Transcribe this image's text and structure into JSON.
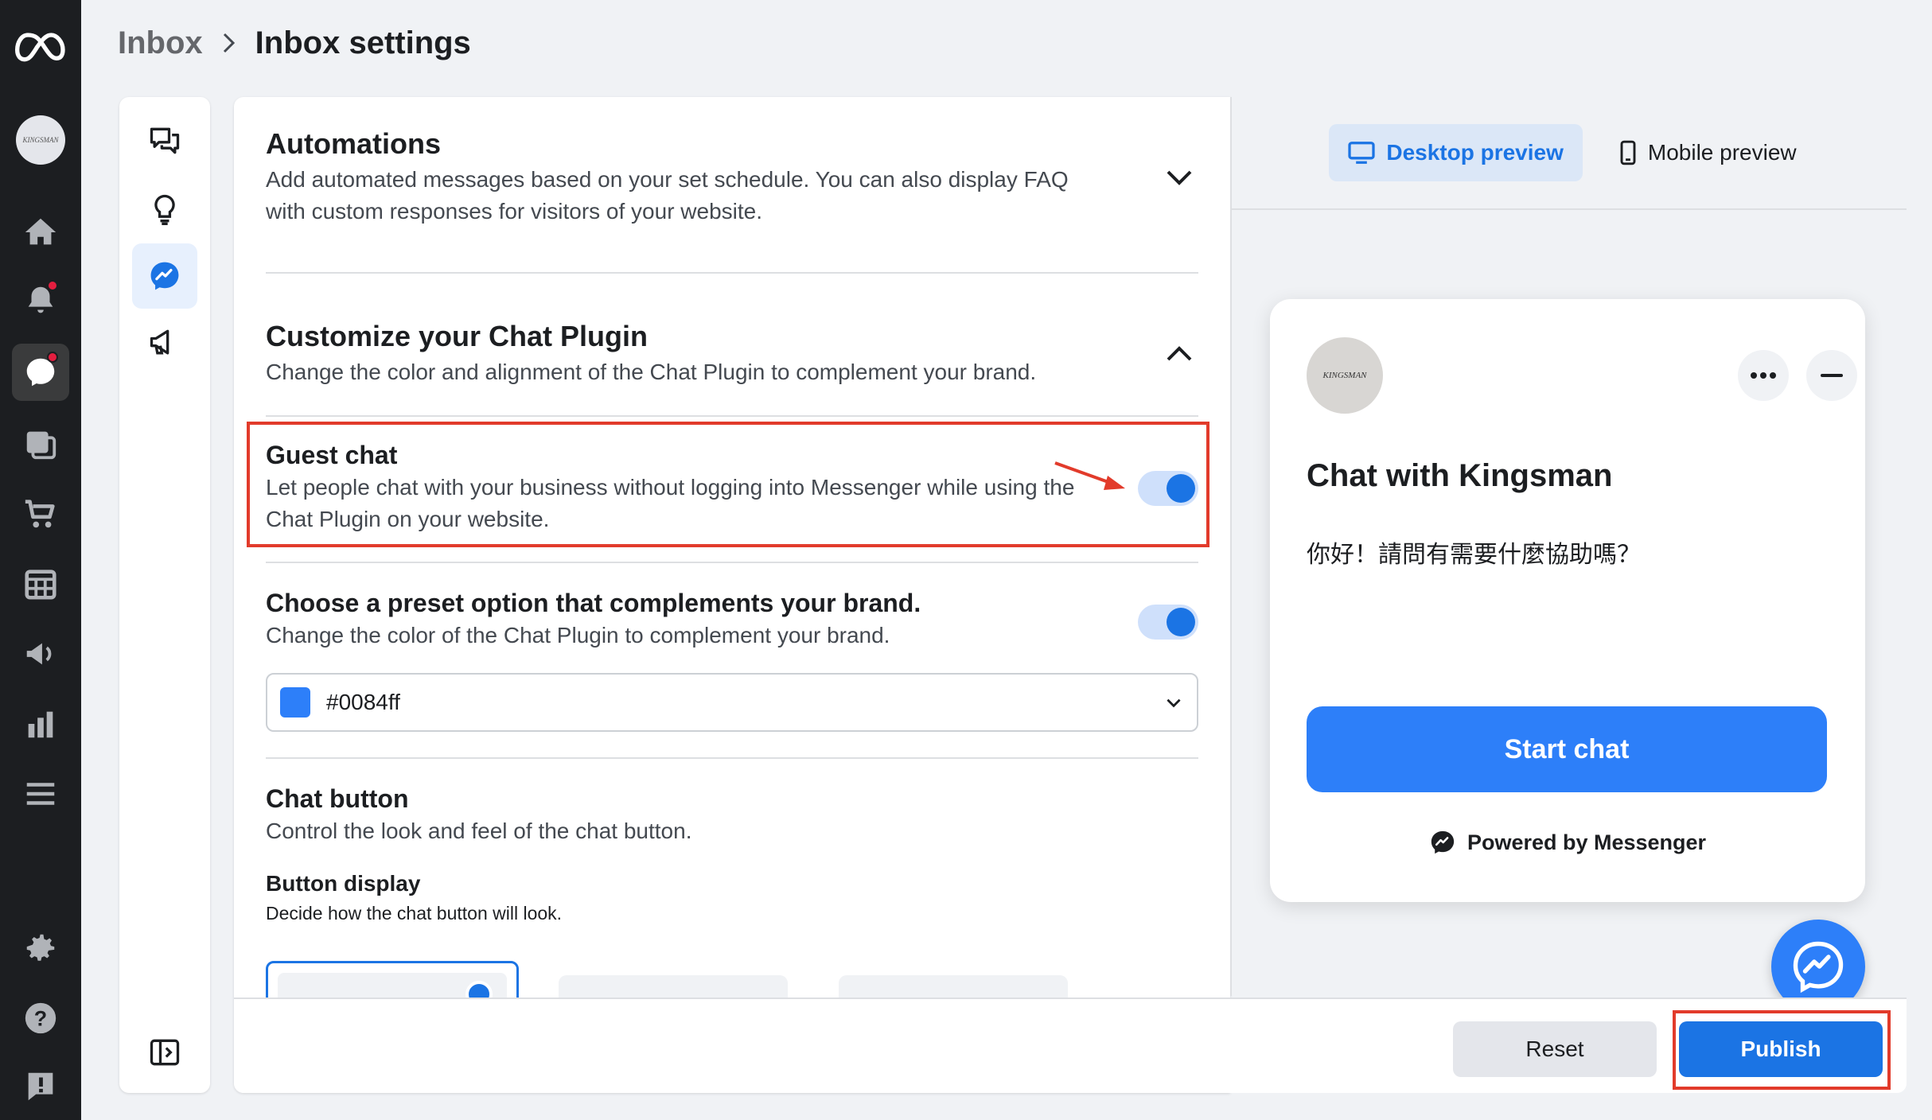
{
  "breadcrumb": {
    "parent": "Inbox",
    "current": "Inbox settings"
  },
  "automations": {
    "title": "Automations",
    "description": "Add automated messages based on your set schedule. You can also display FAQ with custom responses for visitors of your website."
  },
  "customize": {
    "title": "Customize your Chat Plugin",
    "description": "Change the color and alignment of the Chat Plugin to complement your brand."
  },
  "guest_chat": {
    "title": "Guest chat",
    "description": "Let people chat with your business without logging into Messenger while using the Chat Plugin on your website.",
    "enabled": true
  },
  "preset": {
    "title": "Choose a preset option that complements your brand.",
    "description": "Change the color of the Chat Plugin to complement your brand.",
    "enabled": true,
    "color_value": "#0084ff",
    "swatch_color": "#2d7ff9"
  },
  "chat_button": {
    "title": "Chat button",
    "description": "Control the look and feel of the chat button.",
    "display_title": "Button display",
    "display_description": "Decide how the chat button will look."
  },
  "preview_tabs": {
    "desktop": "Desktop preview",
    "mobile": "Mobile preview",
    "active": "desktop"
  },
  "preview": {
    "logo_text": "KINGSMAN",
    "title": "Chat with Kingsman",
    "greeting": "你好！請問有需要什麼協助嗎？",
    "start_button": "Start chat",
    "powered_by": "Powered by Messenger"
  },
  "footer": {
    "reset": "Reset",
    "publish": "Publish"
  },
  "colors": {
    "accent": "#1b74e4",
    "preview_button": "#2d7ff9",
    "annotation": "#e23b2b",
    "sidebar": "#1c1e21"
  },
  "left_nav_icons": [
    "meta-logo-icon",
    "avatar",
    "home-icon",
    "notifications-icon",
    "inbox-icon",
    "pages-icon",
    "commerce-icon",
    "planner-icon",
    "ads-icon",
    "insights-icon",
    "menu-icon",
    "settings-icon",
    "help-icon",
    "report-icon"
  ],
  "sub_nav_icons": [
    "conversations-icon",
    "lightbulb-icon",
    "messenger-icon",
    "megaphone-icon",
    "collapse-panel-icon"
  ]
}
